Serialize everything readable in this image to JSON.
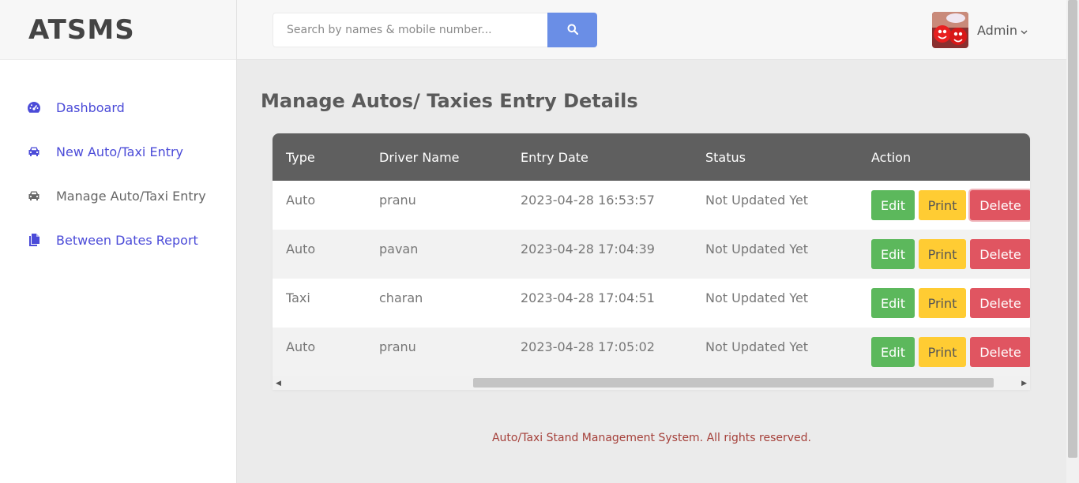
{
  "brand": "ATSMS",
  "sidebar": {
    "items": [
      {
        "label": "Dashboard",
        "icon": "dashboard-icon"
      },
      {
        "label": "New Auto/Taxi Entry",
        "icon": "car-icon"
      },
      {
        "label": "Manage Auto/Taxi Entry",
        "icon": "car-icon"
      },
      {
        "label": "Between Dates Report",
        "icon": "files-icon"
      }
    ]
  },
  "header": {
    "search_placeholder": "Search by names & mobile number...",
    "search_icon": "search-icon",
    "user_name": "Admin"
  },
  "main": {
    "title": "Manage Autos/ Taxies Entry Details",
    "table": {
      "columns": [
        "Type",
        "Driver Name",
        "Entry Date",
        "Status",
        "Action"
      ],
      "rows": [
        {
          "type": "Auto",
          "driver": "pranu",
          "date": "2023-04-28 16:53:57",
          "status": "Not Updated Yet"
        },
        {
          "type": "Auto",
          "driver": "pavan",
          "date": "2023-04-28 17:04:39",
          "status": "Not Updated Yet"
        },
        {
          "type": "Taxi",
          "driver": "charan",
          "date": "2023-04-28 17:04:51",
          "status": "Not Updated Yet"
        },
        {
          "type": "Auto",
          "driver": "pranu",
          "date": "2023-04-28 17:05:02",
          "status": "Not Updated Yet"
        }
      ],
      "actions": {
        "edit": "Edit",
        "print": "Print",
        "delete": "Delete"
      }
    }
  },
  "footer": "Auto/Taxi Stand Management System. All rights reserved.",
  "colors": {
    "accent": "#4b4bd8",
    "header_row": "#5f5f5f",
    "edit": "#5cb85c",
    "print": "#ffcc33",
    "delete": "#e05561",
    "search_button": "#6a8ee6",
    "footer_text": "#a5403a"
  }
}
